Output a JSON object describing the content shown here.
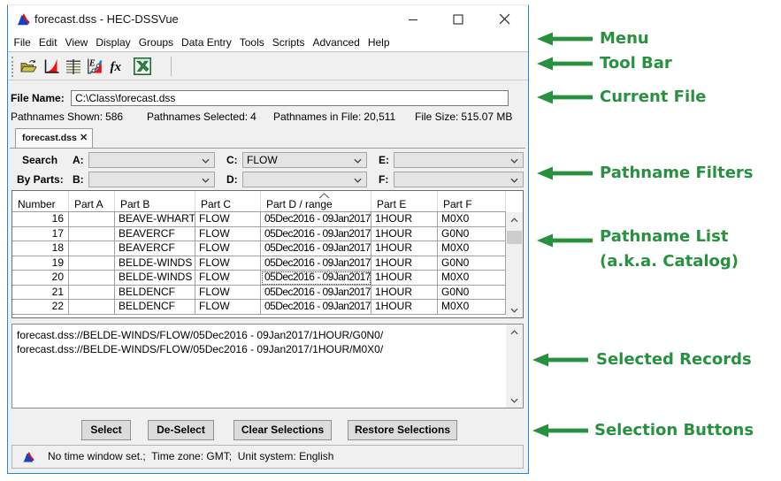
{
  "window": {
    "title": "forecast.dss - HEC-DSSVue",
    "controls": {
      "minimize": "minimize",
      "maximize": "maximize",
      "close": "close"
    },
    "menu": {
      "items": [
        "File",
        "Edit",
        "View",
        "Display",
        "Groups",
        "Data Entry",
        "Tools",
        "Scripts",
        "Advanced",
        "Help"
      ]
    },
    "toolbar": {
      "icons": [
        "open-file-icon",
        "plot-icon",
        "tabulate-icon",
        "edit-plot-icon",
        "math-functions-icon",
        "excel-export-icon"
      ]
    },
    "file_bar": {
      "label": "File Name:",
      "value": "C:\\Class\\forecast.dss"
    },
    "info_bar": {
      "items": [
        {
          "label": "Pathnames Shown:",
          "value": "586"
        },
        {
          "label": "Pathnames Selected:",
          "value": "4"
        },
        {
          "label": "Pathnames in File:",
          "value": "20,511"
        },
        {
          "label": "File Size:",
          "value": "515.07 MB"
        }
      ]
    },
    "tab": {
      "label": "forecast.dss",
      "close_glyph": "✕"
    },
    "filters": {
      "title_line1": "Search",
      "title_line2": "By Parts:",
      "combos": [
        {
          "label": "A:",
          "value": ""
        },
        {
          "label": "C:",
          "value": "FLOW"
        },
        {
          "label": "E:",
          "value": ""
        },
        {
          "label": "B:",
          "value": ""
        },
        {
          "label": "D:",
          "value": ""
        },
        {
          "label": "F:",
          "value": ""
        }
      ]
    },
    "table": {
      "columns": [
        "Number",
        "Part A",
        "Part B",
        "Part C",
        "Part D / range",
        "Part E",
        "Part F"
      ],
      "sorted_column": "Part D / range",
      "rows": [
        [
          "16",
          "",
          "BEAVE-WHART",
          "FLOW",
          "05Dec2016 - 09Jan2017",
          "1HOUR",
          "M0X0"
        ],
        [
          "17",
          "",
          "BEAVERCF",
          "FLOW",
          "05Dec2016 - 09Jan2017",
          "1HOUR",
          "G0N0"
        ],
        [
          "18",
          "",
          "BEAVERCF",
          "FLOW",
          "05Dec2016 - 09Jan2017",
          "1HOUR",
          "M0X0"
        ],
        [
          "19",
          "",
          "BELDE-WINDS",
          "FLOW",
          "05Dec2016 - 09Jan2017",
          "1HOUR",
          "G0N0"
        ],
        [
          "20",
          "",
          "BELDE-WINDS",
          "FLOW",
          "05Dec2016 - 09Jan2017",
          "1HOUR",
          "M0X0"
        ],
        [
          "21",
          "",
          "BELDENCF",
          "FLOW",
          "05Dec2016 - 09Jan2017",
          "1HOUR",
          "G0N0"
        ],
        [
          "22",
          "",
          "BELDENCF",
          "FLOW",
          "05Dec2016 - 09Jan2017",
          "1HOUR",
          "M0X0"
        ]
      ]
    },
    "selected_records": [
      "forecast.dss://BELDE-WINDS/FLOW/05Dec2016 - 09Jan2017/1HOUR/G0N0/",
      "forecast.dss://BELDE-WINDS/FLOW/05Dec2016 - 09Jan2017/1HOUR/M0X0/"
    ],
    "buttons": [
      "Select",
      "De-Select",
      "Clear Selections",
      "Restore Selections"
    ],
    "status": "No time window set.;  Time zone: GMT;  Unit system: English"
  },
  "annotations": [
    {
      "label": "Menu"
    },
    {
      "label": "Tool Bar"
    },
    {
      "label": "Current File"
    },
    {
      "label": "Pathname Filters"
    },
    {
      "label": "Pathname List",
      "label2": "(a.k.a. Catalog)"
    },
    {
      "label": "Selected Records"
    },
    {
      "label": "Selection Buttons"
    }
  ],
  "colors": {
    "window_border": "#2685d8",
    "annotation_green": "#28913f",
    "logo_blue": "#1742c8",
    "logo_red": "#cf1820"
  }
}
